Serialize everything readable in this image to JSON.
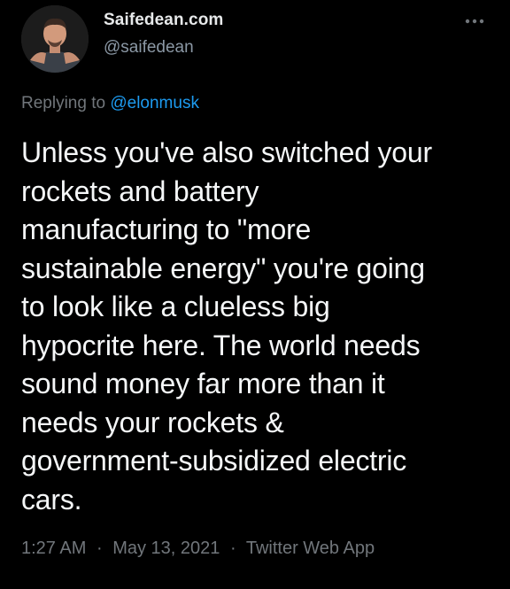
{
  "author": {
    "display_name": "Saifedean.com",
    "handle": "@saifedean",
    "avatar_icon": "profile-photo-icon"
  },
  "menu": {
    "icon": "more-horizontal-icon"
  },
  "reply": {
    "prefix": "Replying to",
    "mention": "@elonmusk"
  },
  "tweet": {
    "lines": [
      "Unless you've also switched your",
      "rockets and battery",
      "manufacturing to \"more",
      "sustainable energy\" you're going",
      "to look like a clueless big",
      "hypocrite here. The world needs",
      "sound money far more than it",
      "needs your rockets &",
      "government-subsidized electric",
      "cars."
    ]
  },
  "meta": {
    "time": "1:27 AM",
    "separator": "·",
    "date": "May 13, 2021",
    "source": "Twitter Web App"
  },
  "colors": {
    "background": "#000000",
    "text": "#e7e9ea",
    "secondary": "#71767b",
    "link": "#1d9bf0"
  }
}
